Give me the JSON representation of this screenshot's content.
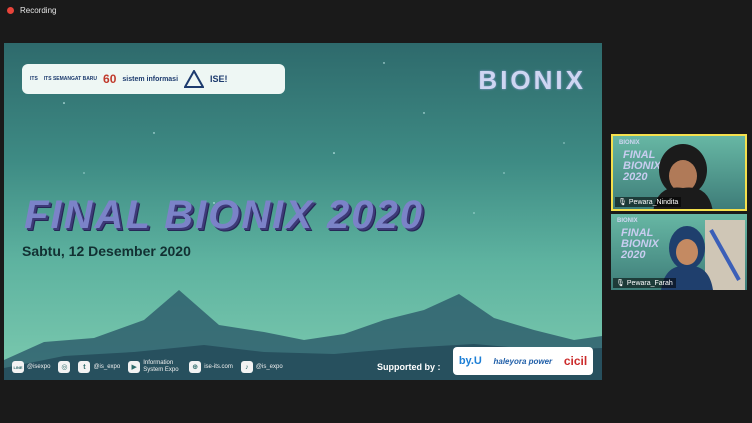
{
  "recording": {
    "label": "Recording"
  },
  "slide": {
    "brand": "BIONIX",
    "title": "FINAL BIONIX 2020",
    "date": "Sabtu, 12 Desember 2020",
    "logos": [
      "ITS",
      "ITS SEMANGAT BARU",
      "60",
      "sistem informasi",
      "ISE!"
    ],
    "socials": [
      {
        "icon": "line-icon",
        "glyph": "LINE",
        "text": "@isexpo"
      },
      {
        "icon": "instagram-icon",
        "glyph": "◎",
        "text": ""
      },
      {
        "icon": "twitter-icon",
        "glyph": "t",
        "text": "@is_expo"
      },
      {
        "icon": "youtube-icon",
        "glyph": "▶",
        "text": "Information System Expo"
      },
      {
        "icon": "website-icon",
        "glyph": "⊕",
        "text": "ise-its.com"
      },
      {
        "icon": "tiktok-icon",
        "glyph": "♪",
        "text": "@is_expo"
      }
    ],
    "supported_label": "Supported by :",
    "sponsors": [
      "by.U",
      "haleyora power",
      "cicil"
    ]
  },
  "participants": [
    {
      "name": "Pewara_Nindita"
    },
    {
      "name": "Pewara_Farah"
    }
  ],
  "colors": {
    "active_speaker_border": "#f4e04d",
    "recording_dot": "#e8443a"
  }
}
